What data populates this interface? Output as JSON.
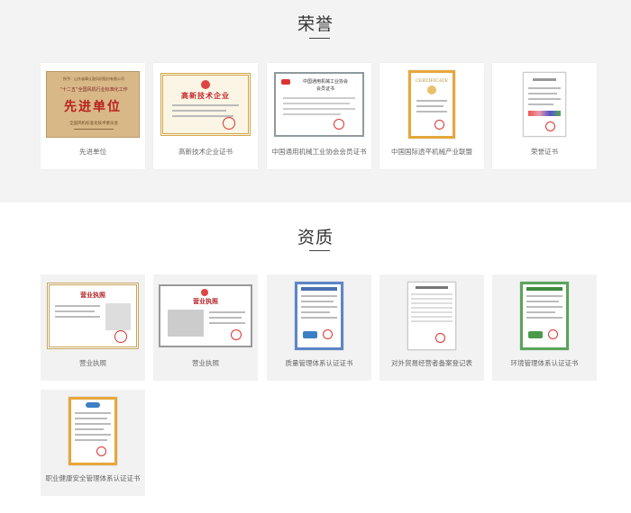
{
  "honors": {
    "title": "荣誉",
    "items": [
      {
        "caption": "先进单位",
        "plaque_line1": "授予：山东省章丘鼓风机股份有限公司",
        "plaque_line2": "“十二五”全国风机行业标准化工作",
        "plaque_main": "先进单位",
        "plaque_line3": "全国风机标准化技术委员会"
      },
      {
        "caption": "高新技术企业证书",
        "cert_title": "高新技术企业"
      },
      {
        "caption": "中国通用机械工业协会会员证书",
        "cert_title": "中国通用机械工业协会",
        "cert_sub": "会员证书"
      },
      {
        "caption": "中国国际透平机械产业联盟",
        "cert_title": "CERTIFICATE"
      },
      {
        "caption": "荣誉证书"
      }
    ]
  },
  "quals": {
    "title": "资质",
    "items": [
      {
        "caption": "营业执照",
        "cert_title": "营业执照"
      },
      {
        "caption": "营业执照",
        "cert_title": "营业执照"
      },
      {
        "caption": "质量管理体系认证证书"
      },
      {
        "caption": "对外贸易经营者备案登记表"
      },
      {
        "caption": "环境管理体系认证证书"
      },
      {
        "caption": "职业健康安全管理体系认证证书"
      }
    ]
  },
  "colors": {
    "honors_bg": "#f3f3f3",
    "card_bg": "#ffffff",
    "qual_card_bg": "#f2f2f2",
    "caption": "#666666",
    "title": "#333333"
  }
}
